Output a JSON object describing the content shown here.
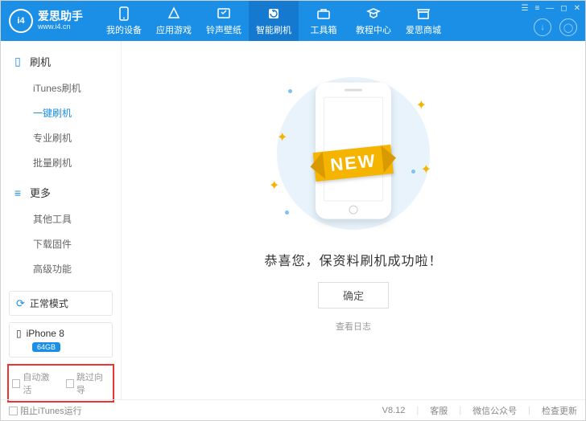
{
  "logo": {
    "title": "爱思助手",
    "subtitle": "www.i4.cn",
    "badge": "i4"
  },
  "nav": [
    {
      "label": "我的设备",
      "icon": "phone"
    },
    {
      "label": "应用游戏",
      "icon": "apps"
    },
    {
      "label": "铃声壁纸",
      "icon": "ringtone"
    },
    {
      "label": "智能刷机",
      "icon": "flash",
      "active": true
    },
    {
      "label": "工具箱",
      "icon": "toolbox"
    },
    {
      "label": "教程中心",
      "icon": "tutorial"
    },
    {
      "label": "爱思商城",
      "icon": "store"
    }
  ],
  "sidebar": {
    "groups": [
      {
        "title": "刷机",
        "items": [
          "iTunes刷机",
          "一键刷机",
          "专业刷机",
          "批量刷机"
        ],
        "activeIndex": 1
      },
      {
        "title": "更多",
        "items": [
          "其他工具",
          "下载固件",
          "高级功能"
        ],
        "activeIndex": -1
      }
    ],
    "mode": "正常模式",
    "device": {
      "name": "iPhone 8",
      "storage": "64GB"
    },
    "checkboxes": {
      "auto_activate": "自动激活",
      "skip_guide": "跳过向导"
    }
  },
  "main": {
    "ribbon": "NEW",
    "message": "恭喜您，保资料刷机成功啦！",
    "ok": "确定",
    "log": "查看日志"
  },
  "statusbar": {
    "block_itunes": "阻止iTunes运行",
    "version": "V8.12",
    "support": "客服",
    "wechat": "微信公众号",
    "update": "检查更新"
  },
  "colors": {
    "primary": "#1b8fe6",
    "accent": "#f4b400"
  }
}
